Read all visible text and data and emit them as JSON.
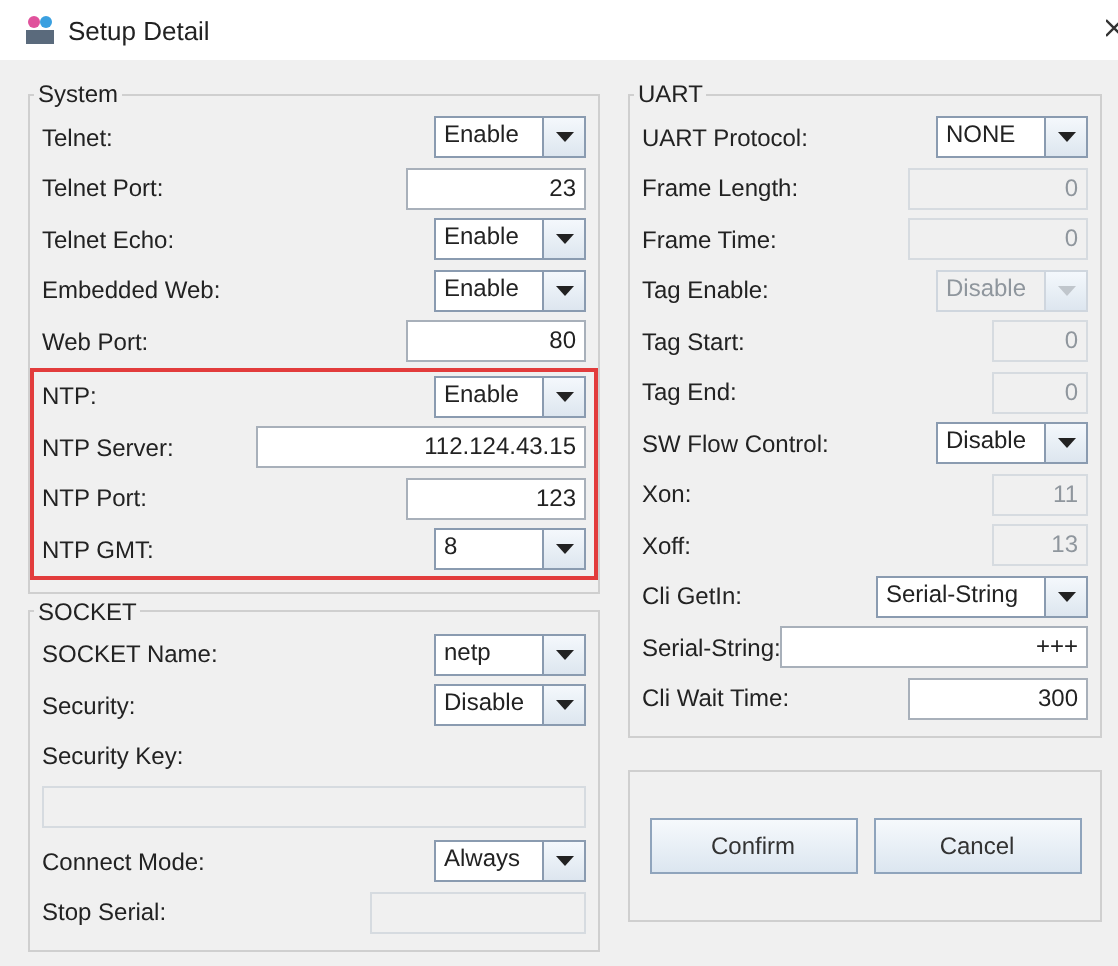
{
  "window": {
    "title": "Setup Detail"
  },
  "left": {
    "groups": [
      {
        "title": "System",
        "rows": [
          {
            "label": "Telnet:",
            "kind": "select",
            "value": "Enable",
            "disabled": false,
            "highlighted": false
          },
          {
            "label": "Telnet Port:",
            "kind": "input",
            "value": "23",
            "disabled": false,
            "highlighted": false
          },
          {
            "label": "Telnet Echo:",
            "kind": "select",
            "value": "Enable",
            "disabled": false,
            "highlighted": false
          },
          {
            "label": "Embedded Web:",
            "kind": "select",
            "value": "Enable",
            "disabled": false,
            "highlighted": false
          },
          {
            "label": "Web Port:",
            "kind": "input",
            "value": "80",
            "disabled": false,
            "highlighted": false
          },
          {
            "label": "NTP:",
            "kind": "select",
            "value": "Enable",
            "disabled": false,
            "highlighted": true
          },
          {
            "label": "NTP Server:",
            "kind": "long-input",
            "value": "112.124.43.15",
            "disabled": false,
            "highlighted": true
          },
          {
            "label": "NTP Port:",
            "kind": "input",
            "value": "123",
            "disabled": false,
            "highlighted": true
          },
          {
            "label": "NTP GMT:",
            "kind": "select",
            "value": "8",
            "disabled": false,
            "highlighted": true
          }
        ]
      },
      {
        "title": "SOCKET",
        "rows": [
          {
            "label": "SOCKET Name:",
            "kind": "select",
            "value": "netp",
            "disabled": false,
            "highlighted": false
          },
          {
            "label": "Security:",
            "kind": "select",
            "value": "Disable",
            "disabled": false,
            "highlighted": false
          },
          {
            "label": "Security Key:",
            "kind": "block-input",
            "disabled": true,
            "highlighted": false
          },
          {
            "label": "Connect Mode:",
            "kind": "select",
            "value": "Always",
            "disabled": false,
            "highlighted": false
          },
          {
            "label": "Stop Serial:",
            "kind": "wide-input",
            "disabled": true,
            "highlighted": false
          }
        ]
      }
    ]
  },
  "right": {
    "groups": [
      {
        "title": "UART",
        "rows": [
          {
            "label": "UART Protocol:",
            "kind": "select",
            "value": "NONE",
            "disabled": false,
            "highlighted": false
          },
          {
            "label": "Frame Length:",
            "kind": "input",
            "value": "0",
            "disabled": true,
            "highlighted": false
          },
          {
            "label": "Frame Time:",
            "kind": "input",
            "value": "0",
            "disabled": true,
            "highlighted": false
          },
          {
            "label": "Tag Enable:",
            "kind": "select",
            "value": "Disable",
            "disabled": true,
            "highlighted": false
          },
          {
            "label": "Tag Start:",
            "kind": "short-input",
            "value": "0",
            "disabled": true,
            "highlighted": false
          },
          {
            "label": "Tag End:",
            "kind": "short-input",
            "value": "0",
            "disabled": true,
            "highlighted": false
          },
          {
            "label": "SW Flow Control:",
            "kind": "select",
            "value": "Disable",
            "disabled": false,
            "highlighted": false
          },
          {
            "label": "Xon:",
            "kind": "short-input",
            "value": "11",
            "disabled": true,
            "highlighted": false
          },
          {
            "label": "Xoff:",
            "kind": "short-input",
            "value": "13",
            "disabled": true,
            "highlighted": false
          },
          {
            "label": "Cli GetIn:",
            "kind": "wide-select",
            "value": "Serial-String",
            "disabled": false,
            "highlighted": false
          },
          {
            "label": "Serial-String:",
            "kind": "long-input",
            "value": "+++",
            "disabled": false,
            "highlighted": false
          },
          {
            "label": "Cli Wait Time:",
            "kind": "input",
            "value": "300",
            "disabled": false,
            "highlighted": false
          }
        ]
      }
    ],
    "buttons": [
      "Confirm",
      "Cancel"
    ]
  }
}
